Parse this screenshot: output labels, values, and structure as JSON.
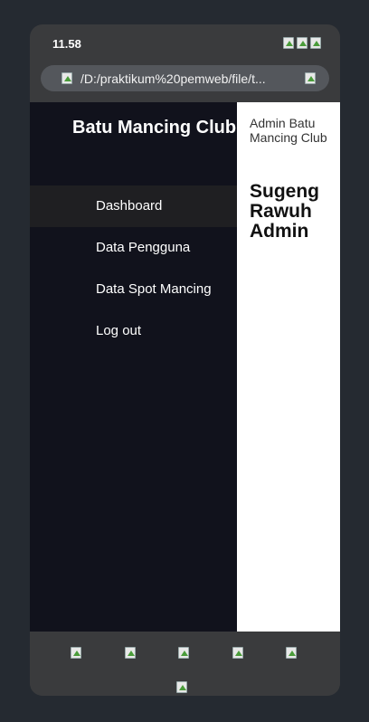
{
  "status_bar": {
    "time": "11.58",
    "icons": [
      "signal-icon",
      "wifi-icon",
      "battery-icon"
    ]
  },
  "browser": {
    "url": "/D:/praktikum%20pemweb/file/t..."
  },
  "sidebar": {
    "brand": "Batu Mancing Club",
    "items": [
      {
        "label": "Dashboard",
        "active": true
      },
      {
        "label": "Data Pengguna",
        "active": false
      },
      {
        "label": "Data Spot Mancing",
        "active": false
      },
      {
        "label": "Log out",
        "active": false
      }
    ]
  },
  "main": {
    "admin_label": "Admin Batu Mancing Club",
    "welcome_title": "Sugeng Rawuh Admin"
  },
  "bottom_nav": {
    "icons": [
      "back-icon",
      "forward-icon",
      "home-icon",
      "tabs-icon",
      "menu-icon",
      "extra-icon"
    ]
  },
  "colors": {
    "page_background": "#252a31",
    "phone_frame": "#3a3b3d",
    "sidebar_background": "#11121c",
    "active_item_background": "#1f1f22",
    "content_background": "#ffffff"
  }
}
